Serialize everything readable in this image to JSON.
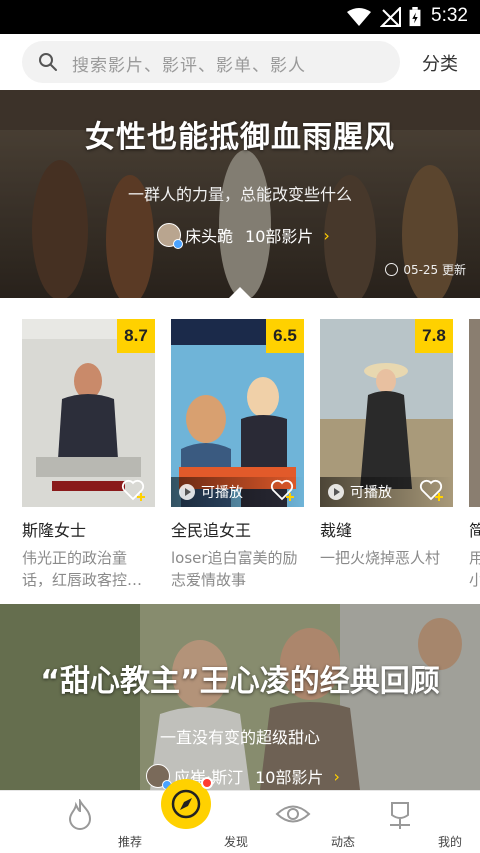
{
  "status_bar": {
    "time": "5:32",
    "icons": [
      "wifi-icon",
      "signal-off-icon",
      "battery-charging-icon"
    ]
  },
  "header": {
    "search_placeholder": "搜索影片、影评、影单、影人",
    "category_label": "分类"
  },
  "banner": {
    "title": "女性也能抵御血雨腥风",
    "subtitle": "一群人的力量，总能改变些什么",
    "author": "床头跪",
    "count": "10部影片",
    "date": "05-25 更新"
  },
  "movies": [
    {
      "title": "斯隆女士",
      "rating": "8.7",
      "desc": "伟光正的政治童话，红唇政客控…",
      "playable": false
    },
    {
      "title": "全民追女王",
      "rating": "6.5",
      "desc": "loser追白富美的励志爱情故事",
      "playable": true,
      "play_label": "可播放"
    },
    {
      "title": "裁缝",
      "rating": "7.8",
      "desc": "一把火烧掉恶人村",
      "playable": true,
      "play_label": "可播放"
    },
    {
      "title": "简",
      "desc": "用小"
    }
  ],
  "banner2": {
    "title": "“甜心教主”王心凌的经典回顾",
    "subtitle": "一直没有变的超级甜心",
    "author": "应崔·斯汀",
    "count": "10部影片"
  },
  "bottom_nav": [
    {
      "label": "推荐",
      "icon": "flame-icon"
    },
    {
      "label": "发现",
      "icon": "compass-icon",
      "active": true
    },
    {
      "label": "动态",
      "icon": "eye-icon"
    },
    {
      "label": "我的",
      "icon": "profile-icon"
    }
  ],
  "colors": {
    "accent": "#ffd100",
    "text_secondary": "#8a8a8a",
    "notification": "#ff3b30"
  }
}
